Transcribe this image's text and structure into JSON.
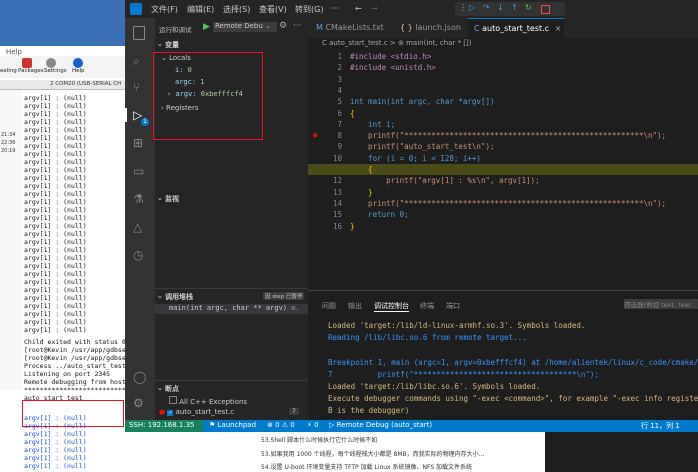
{
  "bg_app": {
    "help_label": "Help",
    "tools": [
      "eeling",
      "Packages",
      "Settings",
      "Help"
    ],
    "tab_label": "2  COM20 (USB-SERIAL CH",
    "side_times": [
      "21:34",
      "22:36",
      "20:19"
    ],
    "lines_top": [
      "argv[1] : (null)",
      "argv[1] : (null)",
      "argv[1] : (null)",
      "argv[1] : (null)",
      "argv[1] : (null)",
      "argv[1] : (null)",
      "argv[1] : (null)",
      "argv[1] : (null)",
      "argv[1] : (null)",
      "argv[1] : (null)",
      "argv[1] : (null)",
      "argv[1] : (null)",
      "argv[1] : (null)",
      "argv[1] : (null)",
      "argv[1] : (null)",
      "argv[1] : (null)",
      "argv[1] : (null)",
      "argv[1] : (null)",
      "argv[1] : (null)",
      "argv[1] : (null)",
      "argv[1] : (null)",
      "argv[1] : (null)",
      "argv[1] : (null)",
      "argv[1] : (null)",
      "argv[1] : (null)",
      "argv[1] : (null)",
      "argv[1] : (null)",
      "argv[1] : (null)",
      "argv[1] : (null)",
      "argv[1] : (null)"
    ],
    "lines_mid": [
      "Child exited with status 0",
      "[root@Kevin /usr/app/gdbse",
      "[root@Kevin /usr/app/gdbse",
      "Process ../auto_start_test",
      "Listening on port 2345",
      "Remote debugging from host",
      "*****************************",
      "auto_start_test"
    ],
    "lines_bottom": [
      "argv[1] : (null)",
      "argv[1] : (null)",
      "argv[1] : (null)",
      "argv[1] : (null)",
      "argv[1] : (null)",
      "argv[1] : (null)",
      "argv[1] : (null)"
    ]
  },
  "title_menu": [
    "文件(F)",
    "编辑(E)",
    "选择(S)",
    "查看(V)",
    "转到(G)",
    "···"
  ],
  "debug_toolbar": {
    "run_label": "运行和调试",
    "config": "Remote Debu"
  },
  "variables": {
    "header": "变量",
    "locals_label": "Locals",
    "items": [
      {
        "name": "i:",
        "value": "0"
      },
      {
        "name": "argc:",
        "value": "1"
      },
      {
        "name": "argv:",
        "value": "0xbefffcf4"
      }
    ],
    "registers_label": "Registers"
  },
  "watch": {
    "header": "监视"
  },
  "callstack": {
    "header": "调用堆栈",
    "badge": "因 step 已暂停",
    "frame": "main(int argc, char ** argv)",
    "frame_file": "a."
  },
  "breakpoints": {
    "header": "断点",
    "items": [
      "All C++ Exceptions",
      "auto_start_test.c"
    ],
    "count": "7"
  },
  "tabs": [
    {
      "label": "auto_start_test.c",
      "active": false
    },
    {
      "label": "CMakeLists.txt",
      "active": false
    },
    {
      "label": "launch.json",
      "active": false
    },
    {
      "label": "auto_start_test.c",
      "active": true
    }
  ],
  "breadcrumb": "C auto_start_test.c > ⊚ main(int, char * [])",
  "code": {
    "lines": [
      {
        "n": "1",
        "t": "#include <stdio.h>"
      },
      {
        "n": "2",
        "t": "#include <unistd.h>"
      },
      {
        "n": "3",
        "t": ""
      },
      {
        "n": "4",
        "t": ""
      },
      {
        "n": "5",
        "t": "int main(int argc, char *argv[])"
      },
      {
        "n": "6",
        "t": "{"
      },
      {
        "n": "7",
        "t": "    int i;"
      },
      {
        "n": "8",
        "t": "    printf(\"*****************************************************\\n\");"
      },
      {
        "n": "9",
        "t": "    printf(\"auto_start_test\\n\");"
      },
      {
        "n": "10",
        "t": "    for (i = 0; i < 128; i++)"
      },
      {
        "n": "11",
        "t": "    {"
      },
      {
        "n": "12",
        "t": "        printf(\"argv[1] : %s\\n\", argv[1]);"
      },
      {
        "n": "13",
        "t": "    }"
      },
      {
        "n": "14",
        "t": "    printf(\"*****************************************************\\n\");"
      },
      {
        "n": "15",
        "t": "    return 0;"
      },
      {
        "n": "16",
        "t": "}"
      }
    ]
  },
  "panel": {
    "tabs": [
      "问题",
      "输出",
      "调试控制台",
      "终端",
      "端口"
    ],
    "filter_placeholder": "筛选器(例如 text, !exc",
    "lines": [
      "Loaded 'target:/lib/ld-linux-armhf.so.3'. Symbols loaded.",
      "Reading /lib/libc.so.6 from remote target...",
      "",
      "Breakpoint 1, main (argc=1, argv=0xbefffcf4) at /home/alientek/linux/c_code/cmake/a",
      "7          printf(\"************************************\\n\");",
      "Loaded 'target:/lib/libc.so.6'. Symbols loaded.",
      "Execute debugger commands using \"-exec <command>\", for example \"-exec info register",
      "B is the debugger)"
    ]
  },
  "statusbar": {
    "ssh": "SSH: 192.168.1.35",
    "launchpad": "Launchpad",
    "problems": "⊗ 0 ⚠ 0",
    "ports": "⚡ 0",
    "debug": "Remote Debug (auto_start)",
    "position": "行 11，列 1"
  },
  "below": {
    "lines": [
      "53.Shell 脚本什么时候执行它什么时候不如",
      "53.如果我用 1000 个线程，每个线程栈大小都是 8MB，而我实际的物理内存大小...",
      "54.设置 U-boot 环境变量支持 TFTP 加载 Linux 系统镜像、NFS 加载文件系统"
    ]
  },
  "colors": {
    "accent": "#007acc",
    "highlight_box": "#e81123",
    "bp_red": "#e51400",
    "current_line": "#4b4b18"
  }
}
